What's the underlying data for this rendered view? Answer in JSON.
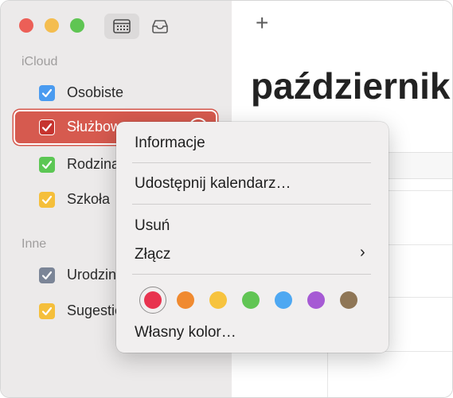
{
  "toolbar": {
    "calendar_view_icon": "calendar-grid-icon",
    "inbox_icon": "inbox-tray-icon",
    "add_label": "+"
  },
  "sidebar": {
    "sections": [
      {
        "label": "iCloud",
        "items": [
          {
            "name": "Osobiste",
            "color": "#4a9bf0",
            "checked": true
          },
          {
            "name": "Służbowe",
            "color": "#e8334f",
            "checked": true,
            "selected": true
          },
          {
            "name": "Rodzina",
            "color": "#5cc754",
            "checked": true
          },
          {
            "name": "Szkoła",
            "color": "#f5bf3b",
            "checked": true
          }
        ]
      },
      {
        "label": "Inne",
        "items": [
          {
            "name": "Urodziny",
            "color": "#7b8597",
            "checked": true
          },
          {
            "name": "Sugestie Siri",
            "color": "#f5bf3b",
            "checked": true
          }
        ]
      }
    ]
  },
  "main": {
    "month_title": "październik"
  },
  "context_menu": {
    "items": {
      "info": "Informacje",
      "share": "Udostępnij kalendarz…",
      "delete": "Usuń",
      "merge": "Złącz",
      "merge_chevron": "›",
      "custom_color": "Własny kolor…"
    },
    "colors": [
      "#e8334f",
      "#f08a30",
      "#f7c33e",
      "#61c554",
      "#4ea8f2",
      "#a65ad4",
      "#8f7656"
    ],
    "selected_color_index": 0
  }
}
